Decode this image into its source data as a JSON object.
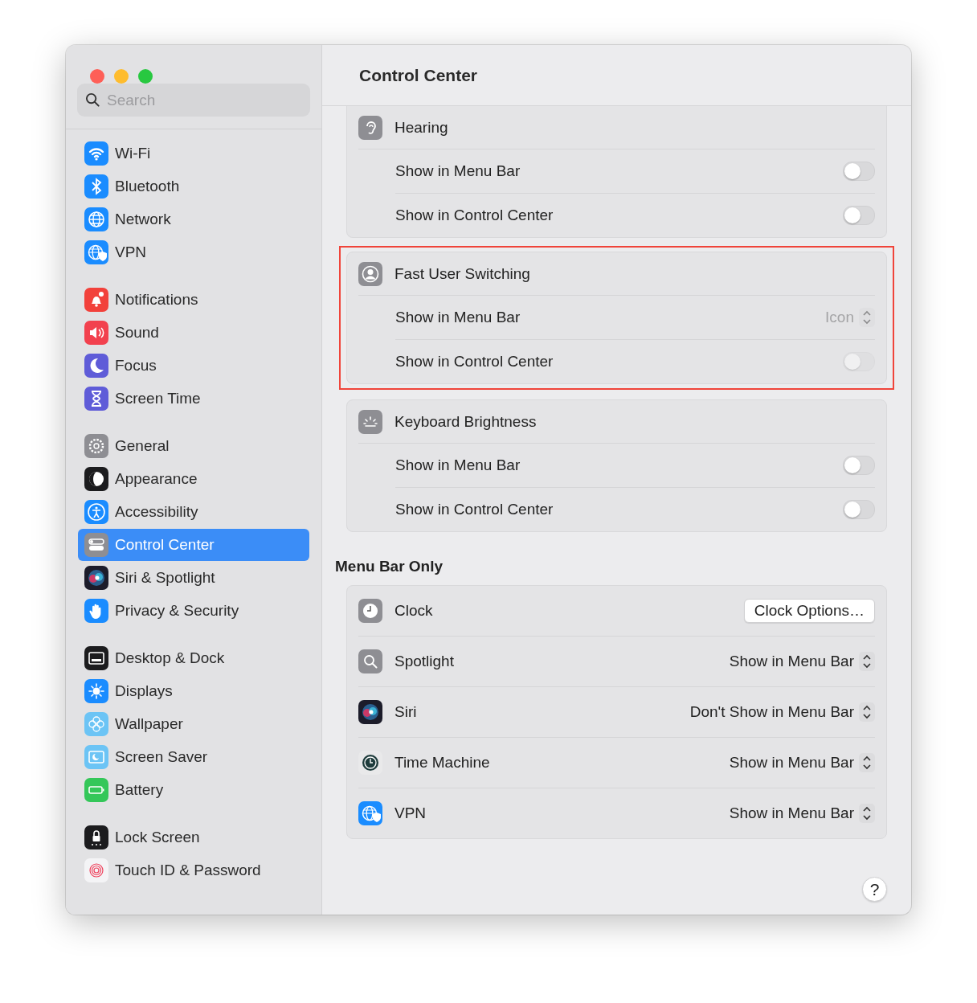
{
  "window": {
    "title": "Control Center"
  },
  "sidebar": {
    "search": {
      "placeholder": "Search"
    },
    "groups": [
      [
        {
          "label": "Wi-Fi",
          "kind": "wifi",
          "selected": false
        },
        {
          "label": "Bluetooth",
          "kind": "bluetooth",
          "selected": false
        },
        {
          "label": "Network",
          "kind": "network",
          "selected": false
        },
        {
          "label": "VPN",
          "kind": "vpn",
          "selected": false
        }
      ],
      [
        {
          "label": "Notifications",
          "kind": "notifications",
          "selected": false
        },
        {
          "label": "Sound",
          "kind": "sound",
          "selected": false
        },
        {
          "label": "Focus",
          "kind": "focus",
          "selected": false
        },
        {
          "label": "Screen Time",
          "kind": "screentime",
          "selected": false
        }
      ],
      [
        {
          "label": "General",
          "kind": "general",
          "selected": false
        },
        {
          "label": "Appearance",
          "kind": "appearance",
          "selected": false
        },
        {
          "label": "Accessibility",
          "kind": "accessibility",
          "selected": false
        },
        {
          "label": "Control Center",
          "kind": "controlcenter",
          "selected": true
        },
        {
          "label": "Siri & Spotlight",
          "kind": "siri",
          "selected": false
        },
        {
          "label": "Privacy & Security",
          "kind": "privacy",
          "selected": false
        }
      ],
      [
        {
          "label": "Desktop & Dock",
          "kind": "desktop",
          "selected": false
        },
        {
          "label": "Displays",
          "kind": "displays",
          "selected": false
        },
        {
          "label": "Wallpaper",
          "kind": "wallpaper",
          "selected": false
        },
        {
          "label": "Screen Saver",
          "kind": "screensaver",
          "selected": false
        },
        {
          "label": "Battery",
          "kind": "battery",
          "selected": false
        }
      ],
      [
        {
          "label": "Lock Screen",
          "kind": "lock",
          "selected": false
        },
        {
          "label": "Touch ID & Password",
          "kind": "touchid",
          "selected": false
        }
      ]
    ]
  },
  "main": {
    "sections": [
      {
        "title": "Hearing",
        "kind": "hearing",
        "highlighted": false,
        "rows": [
          {
            "label": "Show in Menu Bar",
            "kind": "toggle",
            "on": false,
            "disabled": false
          },
          {
            "label": "Show in Control Center",
            "kind": "toggle",
            "on": false,
            "disabled": false
          }
        ]
      },
      {
        "title": "Fast User Switching",
        "kind": "user",
        "highlighted": true,
        "rows": [
          {
            "label": "Show in Menu Bar",
            "kind": "popup",
            "value": "Icon",
            "disabled": true
          },
          {
            "label": "Show in Control Center",
            "kind": "toggle",
            "on": false,
            "disabled": true
          }
        ]
      },
      {
        "title": "Keyboard Brightness",
        "kind": "keyboard",
        "highlighted": false,
        "rows": [
          {
            "label": "Show in Menu Bar",
            "kind": "toggle",
            "on": false,
            "disabled": false
          },
          {
            "label": "Show in Control Center",
            "kind": "toggle",
            "on": false,
            "disabled": false
          }
        ]
      }
    ],
    "menu_bar_only": {
      "heading": "Menu Bar Only",
      "rows": [
        {
          "label": "Clock",
          "kind": "clock",
          "value": "Clock Options…"
        },
        {
          "label": "Spotlight",
          "kind": "spotlight",
          "value": "Show in Menu Bar"
        },
        {
          "label": "Siri",
          "kind": "siri",
          "value": "Don't Show in Menu Bar"
        },
        {
          "label": "Time Machine",
          "kind": "timemachine",
          "value": "Show in Menu Bar"
        },
        {
          "label": "VPN",
          "kind": "vpn",
          "value": "Show in Menu Bar"
        }
      ]
    },
    "help": "?"
  }
}
